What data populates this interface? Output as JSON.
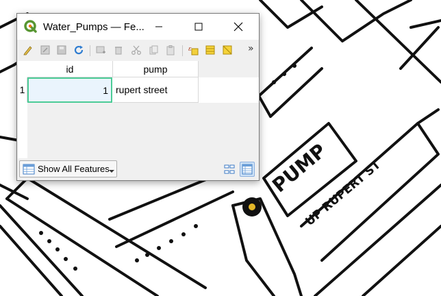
{
  "map": {
    "labels": [
      "PUMP",
      "UP RUPERT ST"
    ]
  },
  "window": {
    "title": "Water_Pumps — Fe...",
    "controls": {
      "minimize": "minimize-icon",
      "maximize": "maximize-icon",
      "close": "close-icon"
    }
  },
  "toolbar": {
    "icons": [
      "toggle-editing-icon",
      "multi-edit-icon",
      "save-edits-icon",
      "reload-icon",
      "add-feature-icon",
      "delete-feature-icon",
      "cut-icon",
      "copy-icon",
      "paste-icon",
      "expression-select-icon",
      "select-all-icon",
      "invert-selection-icon"
    ],
    "overflow": "»"
  },
  "table": {
    "columns": [
      "id",
      "pump"
    ],
    "rows": [
      {
        "row_number": "1",
        "id": "1",
        "pump": "rupert street"
      }
    ]
  },
  "footer": {
    "filter_label": "Show All Features",
    "view_modes": [
      "form-view-icon",
      "table-view-icon"
    ],
    "active_view": "table-view-icon"
  },
  "colors": {
    "qgis_green": "#589632",
    "qgis_yellow": "#ee7913",
    "selected_cell_border": "#4ccb96",
    "map_ink": "#111111"
  }
}
